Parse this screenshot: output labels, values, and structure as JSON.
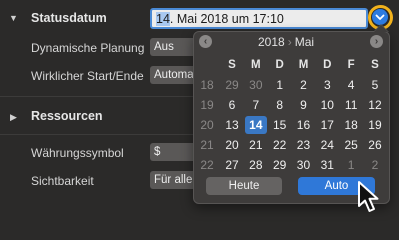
{
  "inspector": {
    "statusdatum": {
      "title": "Statusdatum",
      "value_selected": "14",
      "value_rest": ". Mai 2018 um 17:10"
    },
    "rows": [
      {
        "label": "Dynamische Planung",
        "value": "Aus"
      },
      {
        "label": "Wirklicher Start/Ende",
        "value": "Automa"
      }
    ],
    "ressourcen": {
      "title": "Ressourcen"
    },
    "rows2": [
      {
        "label": "Währungssymbol",
        "value": "$"
      },
      {
        "label": "Sichtbarkeit",
        "value": "Für alle"
      }
    ]
  },
  "calendar": {
    "prev_icon": "chevron-left-icon",
    "next_icon": "chevron-right-icon",
    "year": "2018",
    "separator": "›",
    "month": "Mai",
    "weekdays": [
      "S",
      "M",
      "D",
      "M",
      "D",
      "F",
      "S"
    ],
    "weeks": [
      {
        "wk": "18",
        "days": [
          {
            "d": "29",
            "o": true
          },
          {
            "d": "30",
            "o": true
          },
          {
            "d": "1"
          },
          {
            "d": "2"
          },
          {
            "d": "3"
          },
          {
            "d": "4"
          },
          {
            "d": "5"
          }
        ]
      },
      {
        "wk": "19",
        "days": [
          {
            "d": "6"
          },
          {
            "d": "7"
          },
          {
            "d": "8"
          },
          {
            "d": "9"
          },
          {
            "d": "10"
          },
          {
            "d": "11"
          },
          {
            "d": "12"
          }
        ]
      },
      {
        "wk": "20",
        "days": [
          {
            "d": "13"
          },
          {
            "d": "14",
            "sel": true
          },
          {
            "d": "15"
          },
          {
            "d": "16"
          },
          {
            "d": "17"
          },
          {
            "d": "18"
          },
          {
            "d": "19"
          }
        ]
      },
      {
        "wk": "21",
        "days": [
          {
            "d": "20"
          },
          {
            "d": "21"
          },
          {
            "d": "22"
          },
          {
            "d": "23"
          },
          {
            "d": "24"
          },
          {
            "d": "25"
          },
          {
            "d": "26"
          }
        ]
      },
      {
        "wk": "22",
        "days": [
          {
            "d": "27"
          },
          {
            "d": "28"
          },
          {
            "d": "29"
          },
          {
            "d": "30"
          },
          {
            "d": "31"
          },
          {
            "d": "1",
            "o": true
          },
          {
            "d": "2",
            "o": true
          }
        ]
      }
    ],
    "today_label": "Heute",
    "auto_label": "Auto"
  },
  "colors": {
    "accent": "#2f78d8",
    "highlight_ring": "#f2b21c",
    "selected_day": "#3a78c4"
  }
}
